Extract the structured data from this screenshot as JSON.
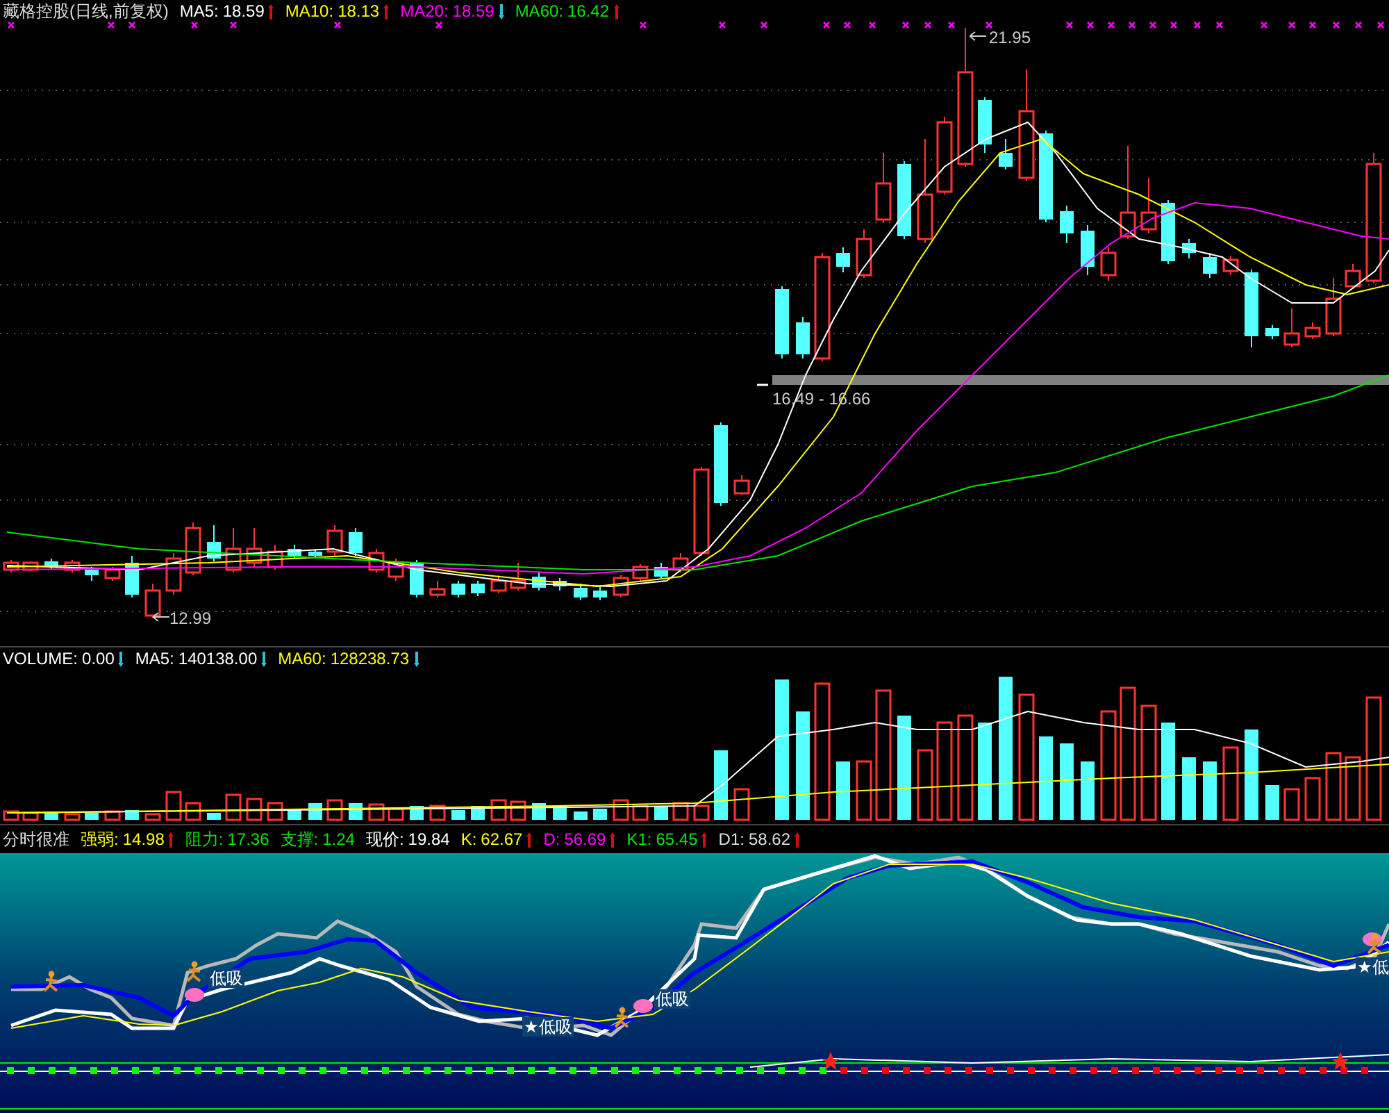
{
  "main_panel": {
    "title": "藏格控股(日线,前复权)",
    "indicators": [
      {
        "label": "MA5:",
        "value": "18.59",
        "color": "#ffffff",
        "rising": true
      },
      {
        "label": "MA10:",
        "value": "18.13",
        "color": "#ffff00",
        "rising": true
      },
      {
        "label": "MA20:",
        "value": "18.59",
        "color": "#ff00ff",
        "rising": false
      },
      {
        "label": "MA60:",
        "value": "16.42",
        "color": "#00e600",
        "rising": true
      }
    ],
    "price_labels": [
      {
        "kind": "high",
        "text": "21.95"
      },
      {
        "kind": "low",
        "text": "12.99"
      },
      {
        "kind": "range",
        "text": "16.49 - 16.66"
      }
    ]
  },
  "volume_panel": {
    "indicators": [
      {
        "label": "VOLUME:",
        "value": "0.00",
        "color": "#ffffff",
        "rising": false
      },
      {
        "label": "MA5:",
        "value": "140138.00",
        "color": "#ffffff",
        "rising": false
      },
      {
        "label": "MA60:",
        "value": "128238.73",
        "color": "#ffff00",
        "rising": false
      }
    ]
  },
  "signal_panel": {
    "title": "分时很准",
    "indicators": [
      {
        "label": "强弱:",
        "value": "14.98",
        "color": "#ffff00",
        "rising": true
      },
      {
        "label": "阻力:",
        "value": "17.36",
        "color": "#00e600"
      },
      {
        "label": "支撑:",
        "value": "1.24",
        "color": "#00e600"
      },
      {
        "label": "现价:",
        "value": "19.84",
        "color": "#ffffff"
      },
      {
        "label": "K:",
        "value": "62.67",
        "color": "#ffff00",
        "rising": true
      },
      {
        "label": "D:",
        "value": "56.69",
        "color": "#ff00ff",
        "rising": true
      },
      {
        "label": "K1:",
        "value": "65.45",
        "color": "#00e600",
        "rising": true
      },
      {
        "label": "D1:",
        "value": "58.62",
        "color": "#dddddd",
        "rising": true
      }
    ],
    "signals": [
      {
        "text": "低吸"
      },
      {
        "text": "★低吸"
      },
      {
        "text": "低吸"
      },
      {
        "text": "★低"
      }
    ]
  }
}
